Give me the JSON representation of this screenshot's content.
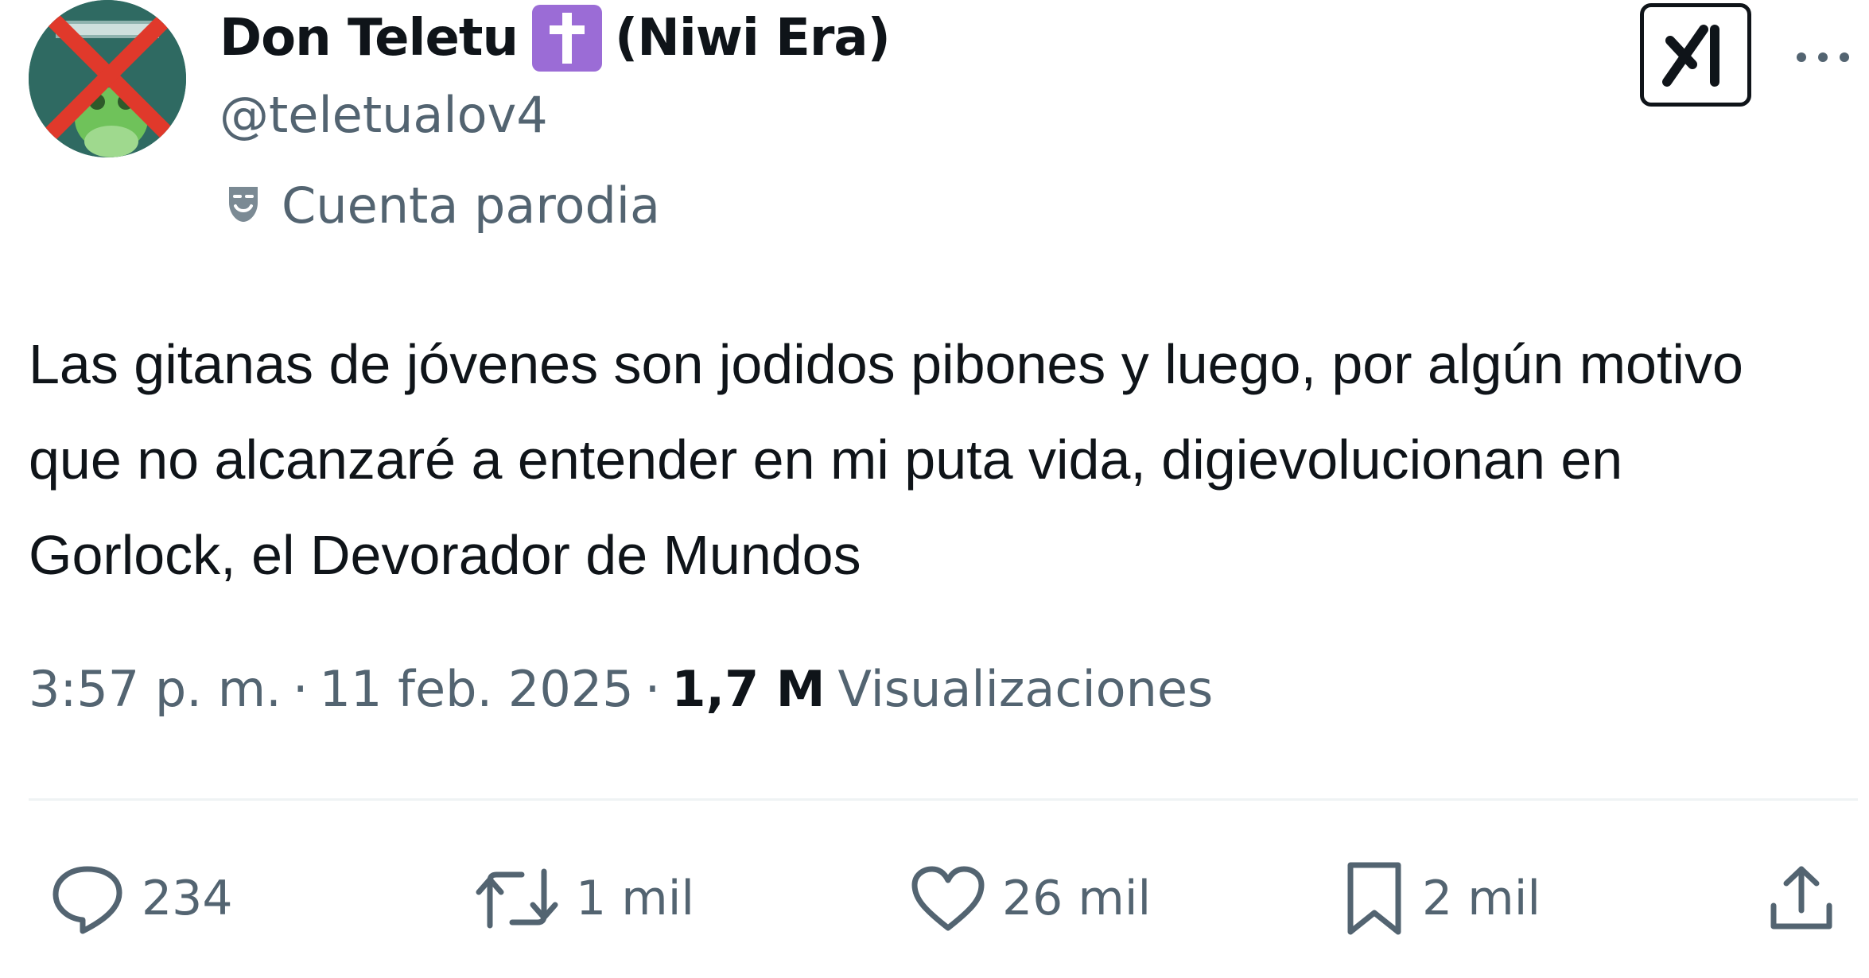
{
  "user": {
    "display_name": "Don Teletu",
    "badge_icon": "latin-cross-emoji",
    "display_name_suffix": "(Niwi Era)",
    "handle": "@teletualov4",
    "account_label": "Cuenta parodia",
    "account_label_icon": "theater-mask-icon"
  },
  "header_actions": {
    "grok_icon": "grok-logo-icon",
    "more_icon": "more-dots-icon"
  },
  "tweet": {
    "text": "Las gitanas de jóvenes son jodidos pibones y luego, por algún motivo que no alcanzaré a entender en mi puta vida, digievolucionan en Gorlock, el Devorador de Mundos"
  },
  "meta": {
    "time": "3:57 p. m.",
    "separator": "·",
    "date": "11 feb. 2025",
    "views_count": "1,7 M",
    "views_label": "Visualizaciones"
  },
  "actions": {
    "replies": "234",
    "reposts": "1 mil",
    "likes": "26 mil",
    "bookmarks": "2 mil"
  },
  "colors": {
    "text_primary": "#0f1419",
    "text_secondary": "#536471",
    "badge": "#9b6cd6",
    "avatar_bg": "#2f6a62",
    "avatar_cross": "#e0392b",
    "divider": "#eff3f4"
  }
}
